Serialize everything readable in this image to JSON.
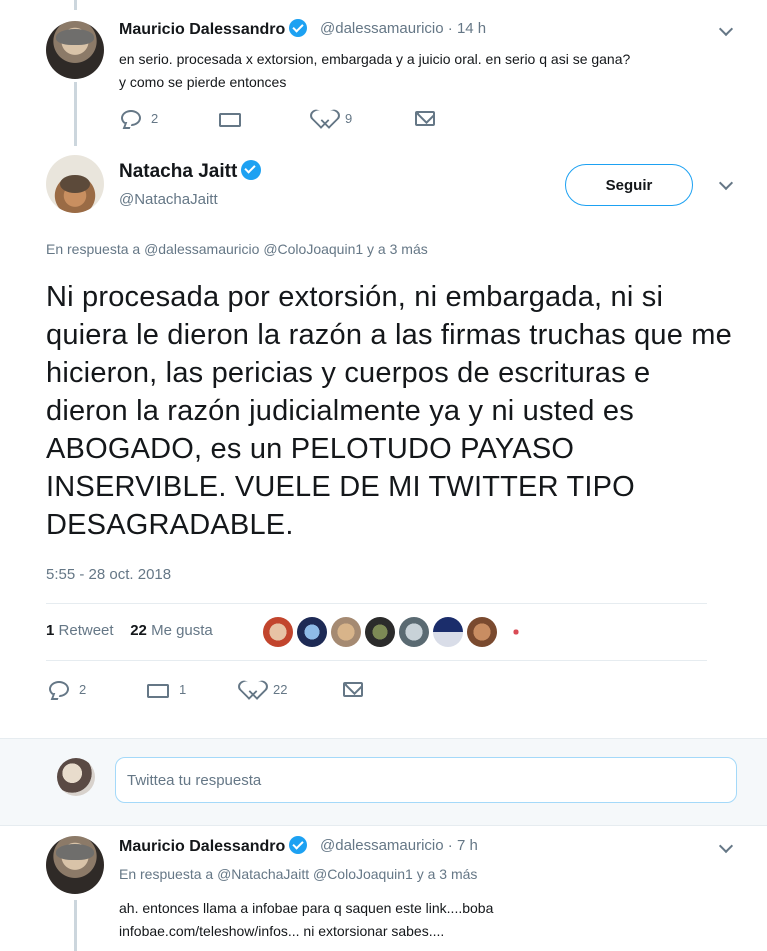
{
  "tweet1": {
    "name": "Mauricio Dalessandro",
    "handle": "@dalessamauricio",
    "time": "· 14 h",
    "text_line1": "en serio. procesada x extorsion, embargada y a juicio oral. en serio q asi se gana?",
    "text_line2": "y como se pierde entonces",
    "replies": "2",
    "retweets": "",
    "likes": "9"
  },
  "main_tweet": {
    "name": "Natacha Jaitt",
    "handle": "@NatachaJaitt",
    "follow_label": "Seguir",
    "reply_prefix": "En respuesta a",
    "reply_users": "@dalessamauricio @ColoJoaquin1",
    "reply_suffix": "y a 3 más",
    "text": "Ni procesada por extorsión, ni embargada, ni si quiera le dieron la razón a las firmas truchas que me hicieron,  las pericias y cuerpos de escrituras e dieron la razón judicialmente ya y ni usted es ABOGADO, es un PELOTUDO PAYASO INSERVIBLE. VUELE DE MI TWITTER TIPO DESAGRADABLE.",
    "timestamp": "5:55 - 28 oct. 2018",
    "retweet_count": "1",
    "retweet_label": "Retweet",
    "like_count": "22",
    "like_label": "Me gusta",
    "replies": "2",
    "retweets": "1",
    "likes": "22"
  },
  "reply_box": {
    "placeholder": "Twittea tu respuesta"
  },
  "tweet3": {
    "name": "Mauricio Dalessandro",
    "handle": "@dalessamauricio",
    "time": "· 7 h",
    "reply_prefix": "En respuesta a",
    "reply_users": "@NatachaJaitt @ColoJoaquin1",
    "reply_suffix": "y a 3 más",
    "text_line1": "ah. entonces llama a infobae para q saquen este link....boba",
    "text_line2": "infobae.com/teleshow/infos... ni extorsionar sabes...."
  },
  "colors": {
    "verified": "#1da1f2",
    "muted": "#657786",
    "text": "#14171a"
  }
}
